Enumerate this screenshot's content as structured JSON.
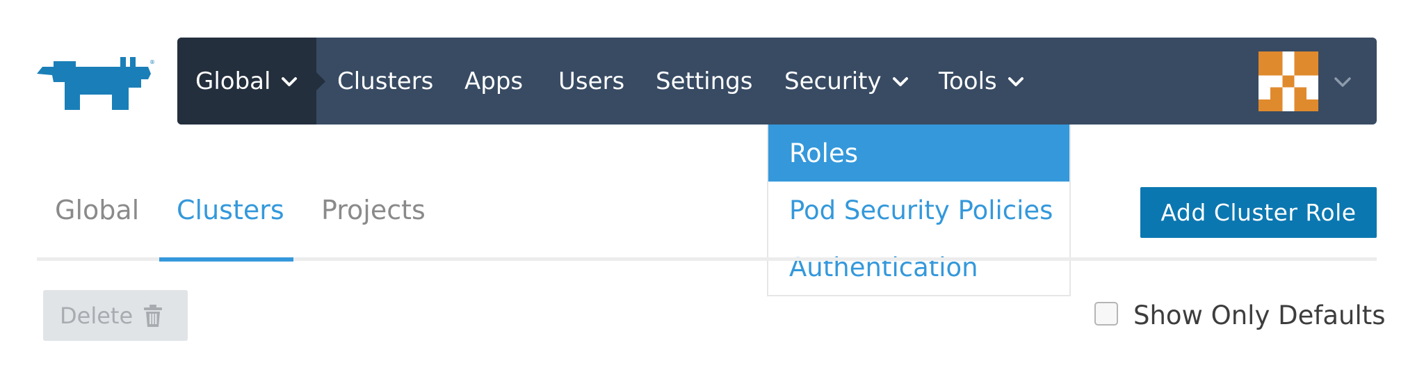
{
  "app": {
    "logo_icon": "rancher-cow-logo-icon",
    "brand_color": "#0b77b0"
  },
  "topnav": {
    "global_label": "Global",
    "items": [
      {
        "label": "Clusters"
      },
      {
        "label": "Apps"
      },
      {
        "label": "Users"
      },
      {
        "label": "Settings"
      },
      {
        "label": "Security",
        "has_dropdown": true
      },
      {
        "label": "Tools",
        "has_dropdown": true
      }
    ],
    "bg_color": "#384b63",
    "global_bg_color": "#232f3d"
  },
  "security_dropdown": {
    "items": [
      {
        "label": "Roles",
        "active": true
      },
      {
        "label": "Pod Security Policies"
      },
      {
        "label": "Authentication"
      }
    ]
  },
  "tabs": {
    "items": [
      {
        "label": "Global"
      },
      {
        "label": "Clusters",
        "active": true
      },
      {
        "label": "Projects"
      }
    ]
  },
  "actions": {
    "add_label": "Add Cluster Role",
    "delete_label": "Delete",
    "show_defaults_label": "Show Only Defaults",
    "show_defaults_checked": false
  }
}
